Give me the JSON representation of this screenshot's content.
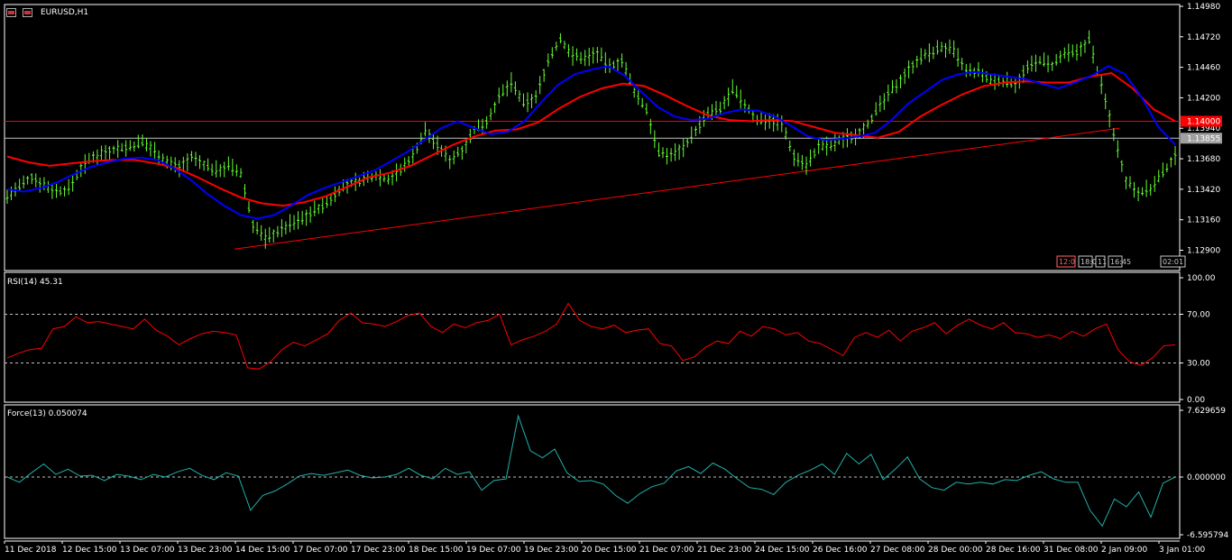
{
  "header": {
    "symbol": "EURUSD,H1"
  },
  "colors": {
    "background": "#000000",
    "grid": "#ffffff",
    "bull_bear_bars": "#66ff33",
    "ma_fast": "#0000ff",
    "ma_slow": "#ff0000",
    "trendline": "#ff0000",
    "horizontal_line_red": "#ff0000",
    "horizontal_line_grey": "#c0c0c0",
    "rsi_line": "#ff0000",
    "force_line": "#20b2aa"
  },
  "icons": [
    "chart-window-icon",
    "symbol-flag-icon"
  ],
  "chart_data": [
    {
      "type": "line",
      "panel": "price",
      "title": "EURUSD,H1",
      "ylim": [
        1.1275,
        1.1498
      ],
      "yticks": [
        "1.14980",
        "1.14720",
        "1.14460",
        "1.14200",
        "1.13940",
        "1.13680",
        "1.13420",
        "1.13160",
        "1.12900"
      ],
      "series": [
        {
          "values": [
            1.1336,
            1.1344,
            1.1352,
            1.1346,
            1.134,
            1.1342,
            1.136,
            1.137,
            1.1374,
            1.1377,
            1.1378,
            1.1382,
            1.1375,
            1.1365,
            1.1361,
            1.1369,
            1.1363,
            1.1358,
            1.1362,
            1.1355,
            1.1312,
            1.13,
            1.1306,
            1.1312,
            1.1317,
            1.1324,
            1.133,
            1.1342,
            1.1347,
            1.135,
            1.1354,
            1.1351,
            1.1358,
            1.1371,
            1.1392,
            1.1379,
            1.1367,
            1.1376,
            1.1392,
            1.14,
            1.142,
            1.1433,
            1.1415,
            1.142,
            1.1452,
            1.147,
            1.1456,
            1.1454,
            1.1458,
            1.1446,
            1.1452,
            1.1425,
            1.141,
            1.1373,
            1.1371,
            1.1378,
            1.1392,
            1.1406,
            1.141,
            1.1427,
            1.1414,
            1.1401,
            1.1401,
            1.1398,
            1.137,
            1.1363,
            1.1378,
            1.1379,
            1.1385,
            1.1388,
            1.1398,
            1.1413,
            1.1427,
            1.144,
            1.1452,
            1.1458,
            1.1463,
            1.146,
            1.1442,
            1.1442,
            1.1434,
            1.1434,
            1.1432,
            1.1445,
            1.1452,
            1.1447,
            1.1457,
            1.1458,
            1.147,
            1.143,
            1.139,
            1.135,
            1.134,
            1.1342,
            1.1356,
            1.137
          ]
        },
        {
          "name": "ma_fast",
          "values": [
            1.1342,
            1.134,
            1.1343,
            1.1348,
            1.1355,
            1.1361,
            1.1365,
            1.1368,
            1.1369,
            1.1367,
            1.136,
            1.135,
            1.1338,
            1.1328,
            1.132,
            1.1317,
            1.132,
            1.1328,
            1.1337,
            1.1343,
            1.1348,
            1.1353,
            1.1358,
            1.1366,
            1.1374,
            1.1384,
            1.1394,
            1.14,
            1.1394,
            1.1389,
            1.1391,
            1.14,
            1.1416,
            1.1431,
            1.144,
            1.1444,
            1.1447,
            1.1439,
            1.1425,
            1.1412,
            1.1404,
            1.1401,
            1.1402,
            1.1407,
            1.141,
            1.1409,
            1.1404,
            1.1396,
            1.1387,
            1.1384,
            1.1385,
            1.1387,
            1.139,
            1.1401,
            1.1415,
            1.1425,
            1.1435,
            1.144,
            1.1442,
            1.144,
            1.1438,
            1.1436,
            1.1432,
            1.1428,
            1.1433,
            1.1439,
            1.1447,
            1.144,
            1.142,
            1.1395,
            1.138
          ]
        },
        {
          "name": "ma_slow",
          "values": [
            1.137,
            1.1365,
            1.1362,
            1.1364,
            1.1366,
            1.1367,
            1.1367,
            1.1364,
            1.136,
            1.1352,
            1.1343,
            1.1335,
            1.133,
            1.1328,
            1.1331,
            1.1336,
            1.1344,
            1.1352,
            1.1356,
            1.1362,
            1.1371,
            1.138,
            1.1387,
            1.1392,
            1.1393,
            1.1399,
            1.1411,
            1.1421,
            1.1428,
            1.1432,
            1.143,
            1.1422,
            1.1413,
            1.1405,
            1.1401,
            1.14,
            1.1401,
            1.14,
            1.1395,
            1.139,
            1.1388,
            1.1386,
            1.1391,
            1.1404,
            1.1414,
            1.1423,
            1.143,
            1.1433,
            1.1434,
            1.1433,
            1.1433,
            1.1438,
            1.1441,
            1.1428,
            1.141,
            1.14
          ]
        }
      ],
      "price_labels": [
        "1.14000",
        "1.13855"
      ],
      "hlines": [
        1.14,
        1.13855
      ],
      "trendline": [
        1.1291,
        1.1394
      ],
      "time_boxes": [
        "12:0",
        "18:0",
        "11",
        "16:45",
        "02:01"
      ]
    },
    {
      "type": "line",
      "panel": "rsi",
      "title": "RSI(14) 45.31",
      "ylim": [
        0,
        100
      ],
      "yticks": [
        "100.00",
        "70.00",
        "30.00",
        "0.00"
      ],
      "levels": [
        70,
        30
      ],
      "series": [
        {
          "values": [
            34,
            38,
            41,
            42,
            58,
            60,
            68,
            63,
            64,
            62,
            60,
            58,
            66,
            57,
            52,
            45,
            50,
            54,
            56,
            55,
            53,
            26,
            25,
            31,
            41,
            47,
            44,
            49,
            54,
            65,
            71,
            63,
            62,
            60,
            64,
            69,
            71,
            60,
            55,
            62,
            59,
            63,
            65,
            70,
            45,
            49,
            52,
            56,
            62,
            79,
            65,
            60,
            58,
            61,
            55,
            57,
            58,
            46,
            44,
            32,
            35,
            43,
            48,
            46,
            56,
            52,
            60,
            58,
            53,
            55,
            48,
            46,
            41,
            36,
            51,
            55,
            51,
            57,
            48,
            56,
            59,
            63,
            54,
            61,
            66,
            61,
            58,
            63,
            55,
            54,
            51,
            53,
            50,
            56,
            52,
            58,
            62,
            41,
            31,
            28,
            34,
            44,
            45
          ]
        }
      ]
    },
    {
      "type": "line",
      "panel": "force",
      "title": "Force(13) 0.050074",
      "ylim": [
        -6.595794,
        7.629659
      ],
      "yticks": [
        "7.629659",
        "0.000000",
        "-6.595794"
      ],
      "levels": [
        0
      ],
      "series": [
        {
          "values": [
            0.0,
            -0.6,
            0.5,
            1.5,
            0.3,
            0.9,
            0.1,
            0.2,
            -0.4,
            0.3,
            0.1,
            -0.3,
            0.3,
            0.0,
            0.6,
            1.0,
            0.2,
            -0.3,
            0.5,
            0.1,
            -3.8,
            -2.1,
            -1.6,
            -0.8,
            0.1,
            0.4,
            0.2,
            0.5,
            0.8,
            0.2,
            -0.1,
            0.0,
            0.3,
            1.0,
            0.2,
            -0.2,
            1.0,
            0.3,
            0.6,
            -1.5,
            -0.4,
            -0.2,
            7.0,
            3.0,
            2.2,
            3.2,
            0.5,
            -0.5,
            -0.4,
            -0.8,
            -2.1,
            -3.0,
            -1.9,
            -1.1,
            -0.7,
            0.7,
            1.2,
            0.4,
            1.6,
            0.9,
            -0.2,
            -1.2,
            -1.4,
            -2.0,
            -0.6,
            0.2,
            0.8,
            1.5,
            0.3,
            2.7,
            1.5,
            2.6,
            -0.3,
            0.9,
            2.3,
            -0.2,
            -1.2,
            -1.5,
            -0.6,
            -0.8,
            -0.6,
            -0.8,
            -0.3,
            -0.4,
            0.2,
            0.6,
            -0.2,
            -0.6,
            -0.6,
            -3.8,
            -5.6,
            -2.5,
            -3.4,
            -1.7,
            -4.6,
            -0.7,
            0.0
          ]
        }
      ]
    }
  ],
  "x_axis": {
    "labels": [
      "11 Dec 2018",
      "12 Dec 15:00",
      "13 Dec 07:00",
      "13 Dec 23:00",
      "14 Dec 15:00",
      "17 Dec 07:00",
      "17 Dec 23:00",
      "18 Dec 15:00",
      "19 Dec 07:00",
      "19 Dec 23:00",
      "20 Dec 15:00",
      "21 Dec 07:00",
      "21 Dec 23:00",
      "24 Dec 15:00",
      "26 Dec 16:00",
      "27 Dec 08:00",
      "28 Dec 00:00",
      "28 Dec 16:00",
      "31 Dec 08:00",
      "2 Jan 09:00",
      "3 Jan 01:00"
    ]
  }
}
